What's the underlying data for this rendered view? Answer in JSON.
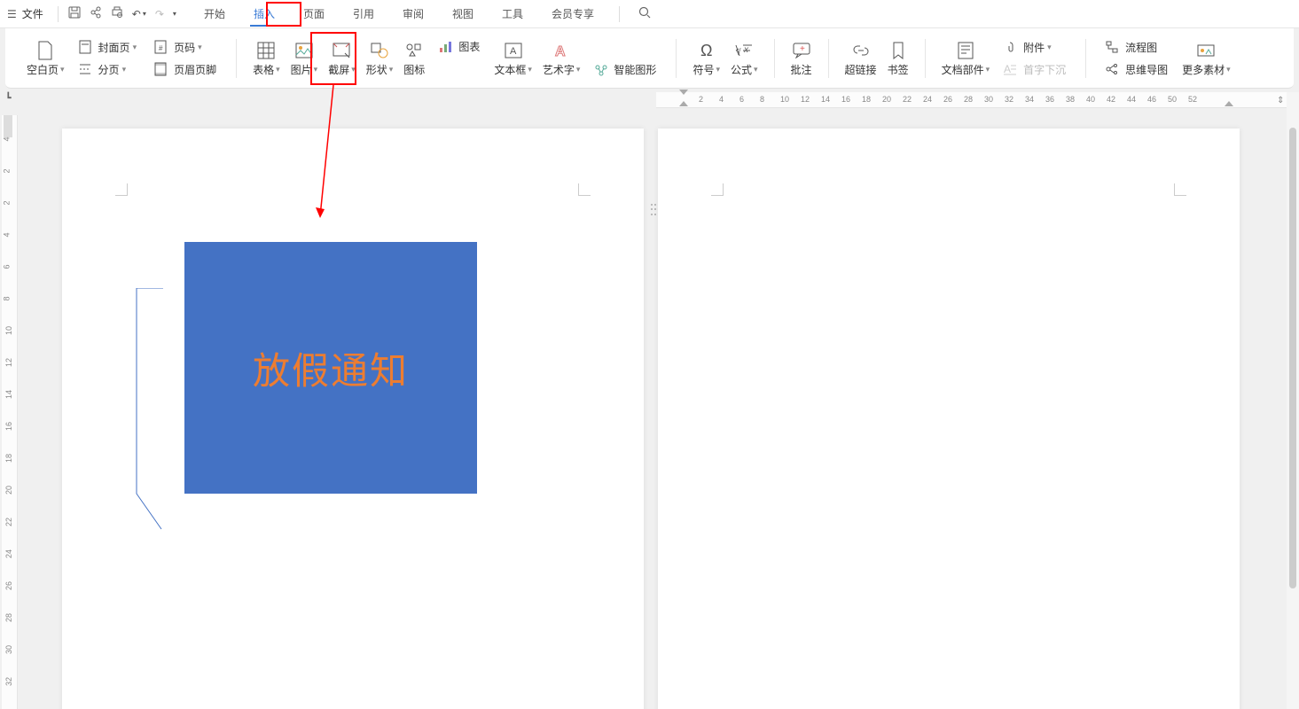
{
  "menubar": {
    "file_label": "文件",
    "qat": {
      "save": "保存",
      "share": "分享",
      "print": "输出",
      "undo": "撤销",
      "redo": "重做"
    },
    "tabs": {
      "start": "开始",
      "insert": "插入",
      "page": "页面",
      "reference": "引用",
      "review": "审阅",
      "view": "视图",
      "tools": "工具",
      "member": "会员专享"
    }
  },
  "ribbon": {
    "blank_page": "空白页",
    "cover": "封面页",
    "section_break": "分页",
    "page_number": "页码",
    "header_footer": "页眉页脚",
    "table": "表格",
    "picture": "图片",
    "screenshot": "截屏",
    "shape": "形状",
    "icon": "图标",
    "chart": "图表",
    "textbox": "文本框",
    "wordart": "艺术字",
    "smartart": "智能图形",
    "symbol": "符号",
    "equation": "公式",
    "comment": "批注",
    "hyperlink": "超链接",
    "bookmark": "书签",
    "doc_parts": "文档部件",
    "dropcap": "首字下沉",
    "attachment": "附件",
    "flowchart": "流程图",
    "mindmap": "思维导图",
    "more_material": "更多素材"
  },
  "hruler": {
    "ticks": [
      "2",
      "4",
      "6",
      "8",
      "10",
      "12",
      "14",
      "16",
      "18",
      "20",
      "22",
      "24",
      "26",
      "28",
      "30",
      "32",
      "34",
      "36",
      "38",
      "40",
      "42",
      "44",
      "46",
      "50",
      "52"
    ]
  },
  "vruler": {
    "ticks": [
      "4",
      "2",
      "2",
      "4",
      "6",
      "8",
      "10",
      "12",
      "14",
      "16",
      "18",
      "20",
      "22",
      "24",
      "26",
      "28",
      "30",
      "32"
    ]
  },
  "document": {
    "shape_text": "放假通知"
  },
  "annotations": {
    "insert_tab_highlighted": true,
    "shape_tool_highlighted": true,
    "arrow_target": "形状"
  }
}
